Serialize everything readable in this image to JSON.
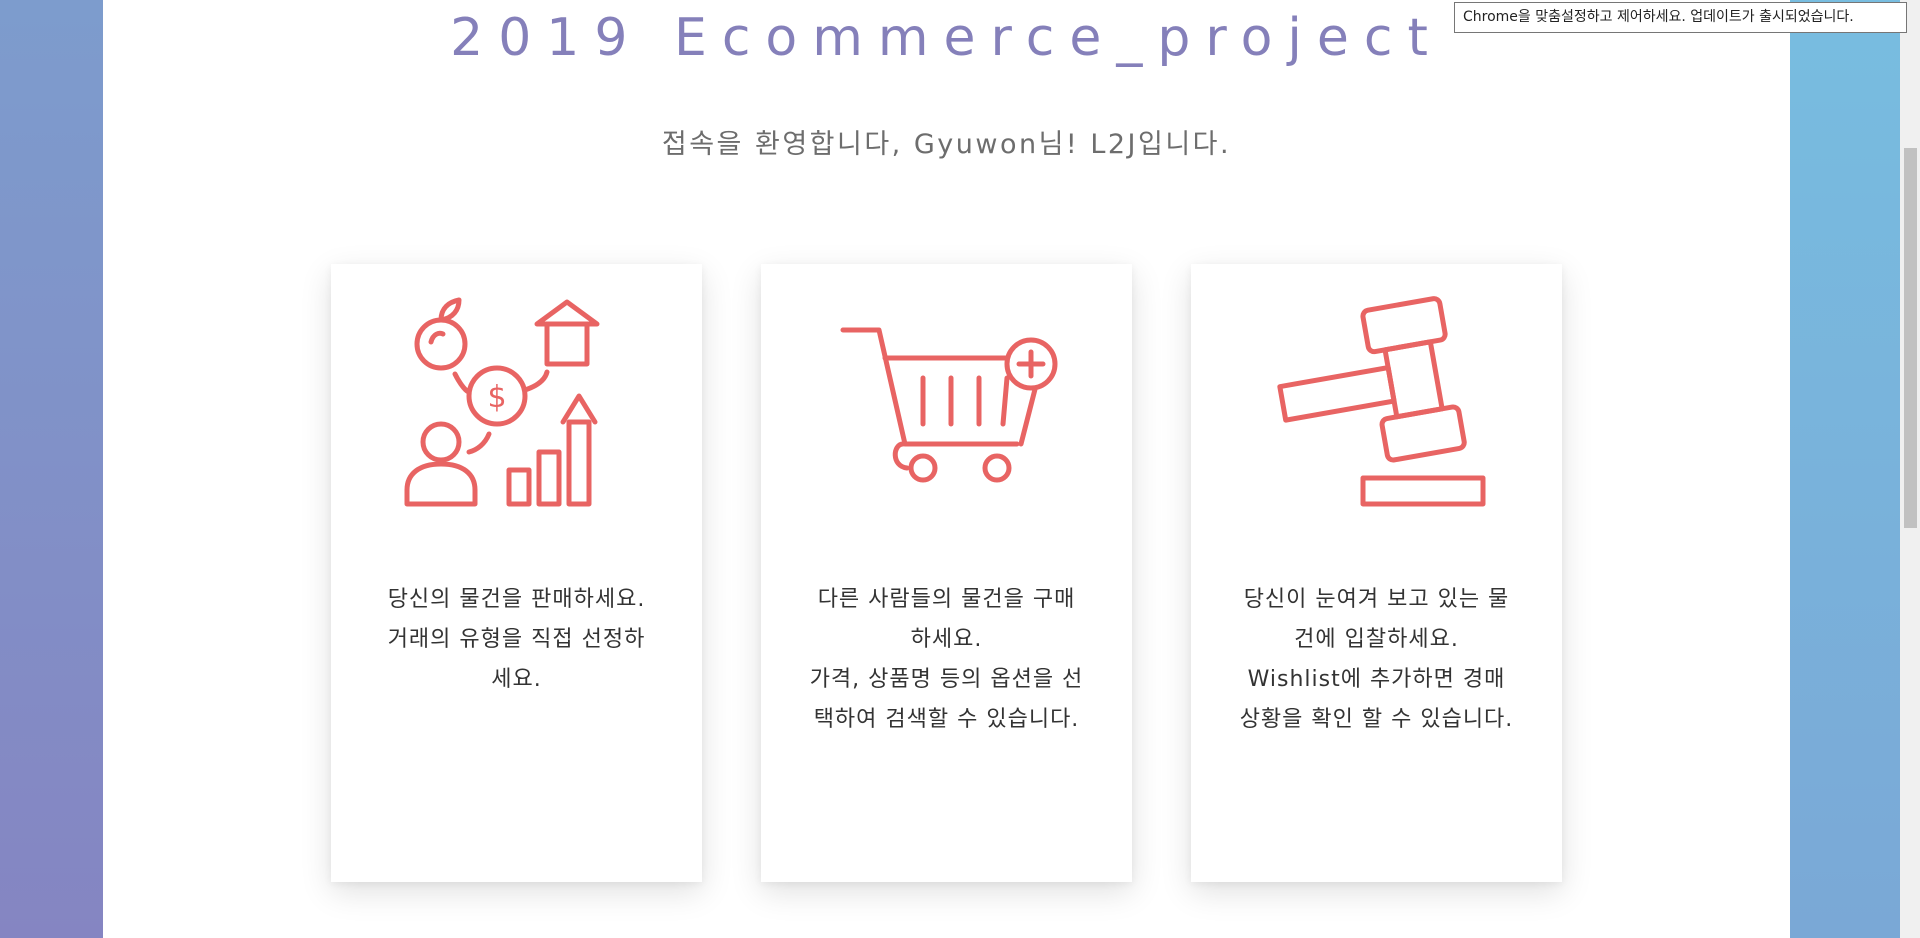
{
  "browser": {
    "tooltip": "Chrome을 맞춤설정하고 제어하세요. 업데이트가 출시되었습니다."
  },
  "header": {
    "title": "2019 Ecommerce_project",
    "welcome": "접속을 환영합니다, Gyuwon님! L2J입니다."
  },
  "colors": {
    "accent": "#e86463",
    "title": "#8580ba"
  },
  "cards": [
    {
      "icon": "sell-growth-icon",
      "text": "당신의 물건을 판매하세요.\n거래의 유형을 직접 선정하\n세요."
    },
    {
      "icon": "shopping-cart-add-icon",
      "text": "다른 사람들의 물건을 구매\n하세요.\n가격, 상품명 등의 옵션을 선\n택하여 검색할 수 있습니다."
    },
    {
      "icon": "auction-gavel-icon",
      "text": "당신이 눈여겨 보고 있는 물\n건에 입찰하세요.\nWishlist에 추가하면 경매\n상황을 확인 할 수 있습니다."
    }
  ]
}
